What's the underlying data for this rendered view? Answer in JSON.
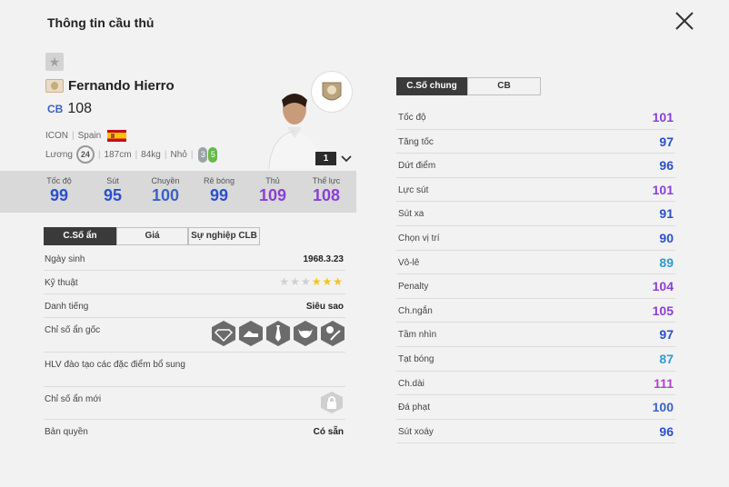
{
  "title": "Thông tin cầu thủ",
  "colors": {
    "blue": "#3a62c8",
    "purple": "#8a3fd6",
    "magenta": "#b33fd6",
    "teal": "#2d9bd1",
    "dark_blue": "#2b4fcf"
  },
  "player": {
    "name": "Fernando Hierro",
    "position": "CB",
    "ovr": "108",
    "season": "ICON",
    "nation": "Spain",
    "wage_label": "Lương",
    "wage": "24",
    "height": "187cm",
    "weight": "84kg",
    "body": "Nhỏ",
    "weak_foot": "3",
    "strong_foot": "5",
    "level": "1"
  },
  "summary_stats": [
    {
      "label": "Tốc độ",
      "value": "99",
      "color": "#2b4fcf"
    },
    {
      "label": "Sút",
      "value": "95",
      "color": "#2b4fcf"
    },
    {
      "label": "Chuyền",
      "value": "100",
      "color": "#3a62c8"
    },
    {
      "label": "Rê bóng",
      "value": "99",
      "color": "#2b4fcf"
    },
    {
      "label": "Thủ",
      "value": "109",
      "color": "#8a3fd6"
    },
    {
      "label": "Thể lực",
      "value": "108",
      "color": "#8a3fd6"
    }
  ],
  "left_tabs": [
    "C.Số ẩn",
    "Giá",
    "Sự nghiệp CLB"
  ],
  "info": {
    "birth_label": "Ngày sinh",
    "birth": "1968.3.23",
    "skill_label": "Kỹ thuật",
    "skill_stars": 3,
    "skill_max": 6,
    "rep_label": "Danh tiếng",
    "rep": "Siêu sao",
    "hidden_label": "Chỉ số ẩn gốc",
    "coach_label": "HLV đào tạo các đặc điểm bổ sung",
    "new_hidden_label": "Chỉ số ẩn mới",
    "rights_label": "Bản quyền",
    "rights": "Có sẵn"
  },
  "trait_icons": [
    "diamond-trait-icon",
    "boots-trait-icon",
    "tie-trait-icon",
    "bull-trait-icon",
    "ball-trait-icon"
  ],
  "right_tabs": [
    "C.Số chung",
    "CB"
  ],
  "attributes": [
    {
      "label": "Tốc độ",
      "value": "101",
      "color": "#8a3fd6"
    },
    {
      "label": "Tăng tốc",
      "value": "97",
      "color": "#2b4fcf"
    },
    {
      "label": "Dứt điểm",
      "value": "96",
      "color": "#2b4fcf"
    },
    {
      "label": "Lực sút",
      "value": "101",
      "color": "#8a3fd6"
    },
    {
      "label": "Sút xa",
      "value": "91",
      "color": "#2b4fcf"
    },
    {
      "label": "Chọn vị trí",
      "value": "90",
      "color": "#2b4fcf"
    },
    {
      "label": "Vô-lê",
      "value": "89",
      "color": "#2d9bd1"
    },
    {
      "label": "Penalty",
      "value": "104",
      "color": "#8a3fd6"
    },
    {
      "label": "Ch.ngắn",
      "value": "105",
      "color": "#8a3fd6"
    },
    {
      "label": "Tầm nhìn",
      "value": "97",
      "color": "#2b4fcf"
    },
    {
      "label": "Tạt bóng",
      "value": "87",
      "color": "#2d9bd1"
    },
    {
      "label": "Ch.dài",
      "value": "111",
      "color": "#b33fd6"
    },
    {
      "label": "Đá phạt",
      "value": "100",
      "color": "#3a62c8"
    },
    {
      "label": "Sút xoáy",
      "value": "96",
      "color": "#2b4fcf"
    }
  ]
}
